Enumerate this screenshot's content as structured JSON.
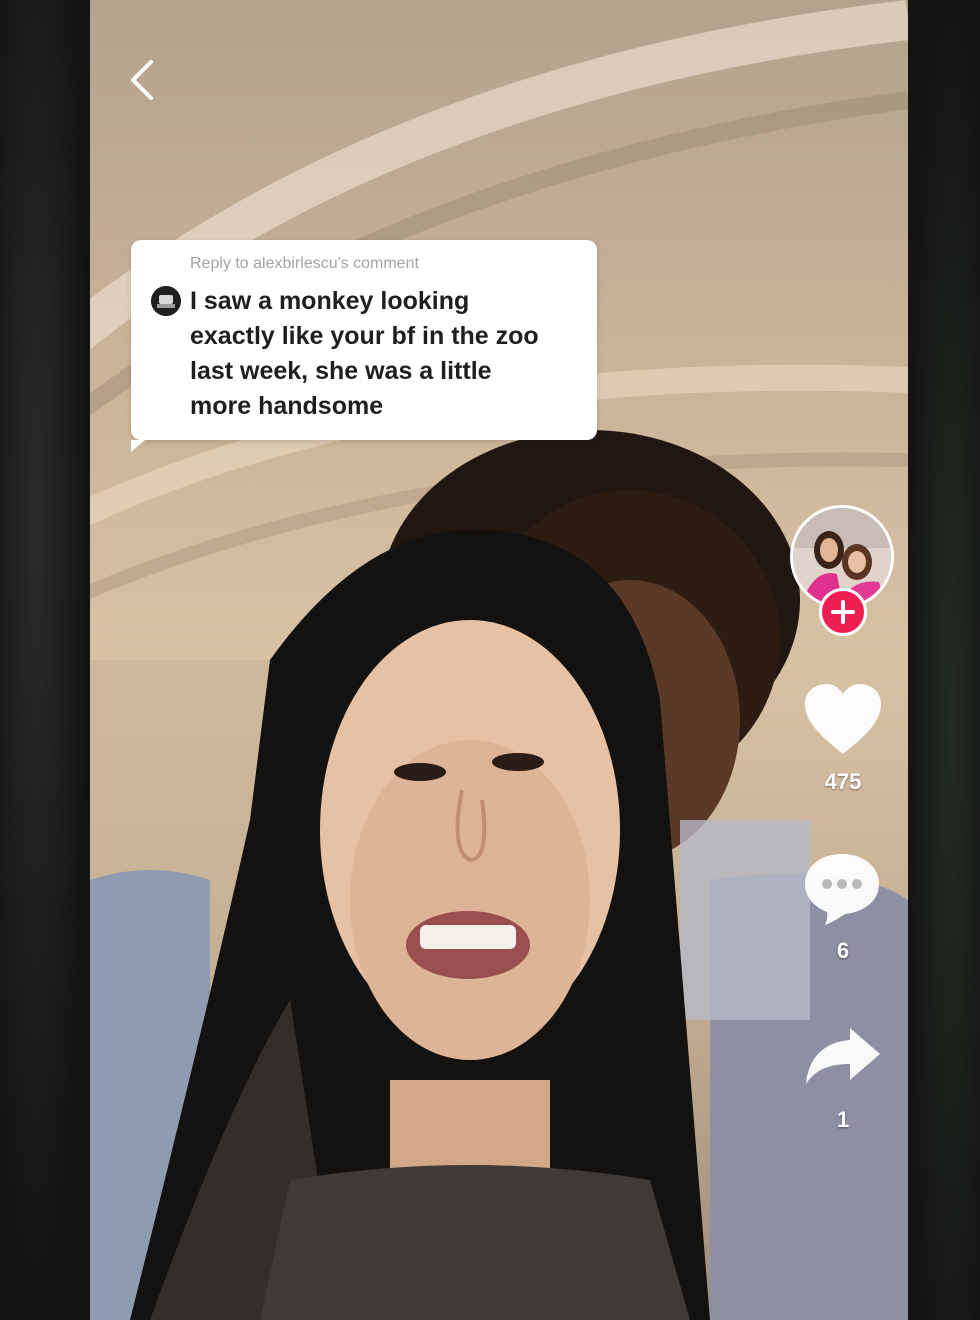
{
  "nav": {
    "back_icon": "chevron-left-icon"
  },
  "reply": {
    "header": "Reply to alexbirlescu's comment",
    "text": "I saw a monkey looking\nexactly like your bf in the zoo\nlast week, she was a little\nmore handsome",
    "avatar_icon": "commenter-avatar"
  },
  "sidebar": {
    "follow_icon": "plus-icon",
    "like_icon": "heart-icon",
    "like_count": "475",
    "comment_icon": "comment-bubble-icon",
    "comment_count": "6",
    "share_icon": "share-arrow-icon",
    "share_count": "1"
  },
  "colors": {
    "follow_button": "#ee1d52",
    "reply_card": "#ffffff",
    "icon": "#ffffff"
  }
}
